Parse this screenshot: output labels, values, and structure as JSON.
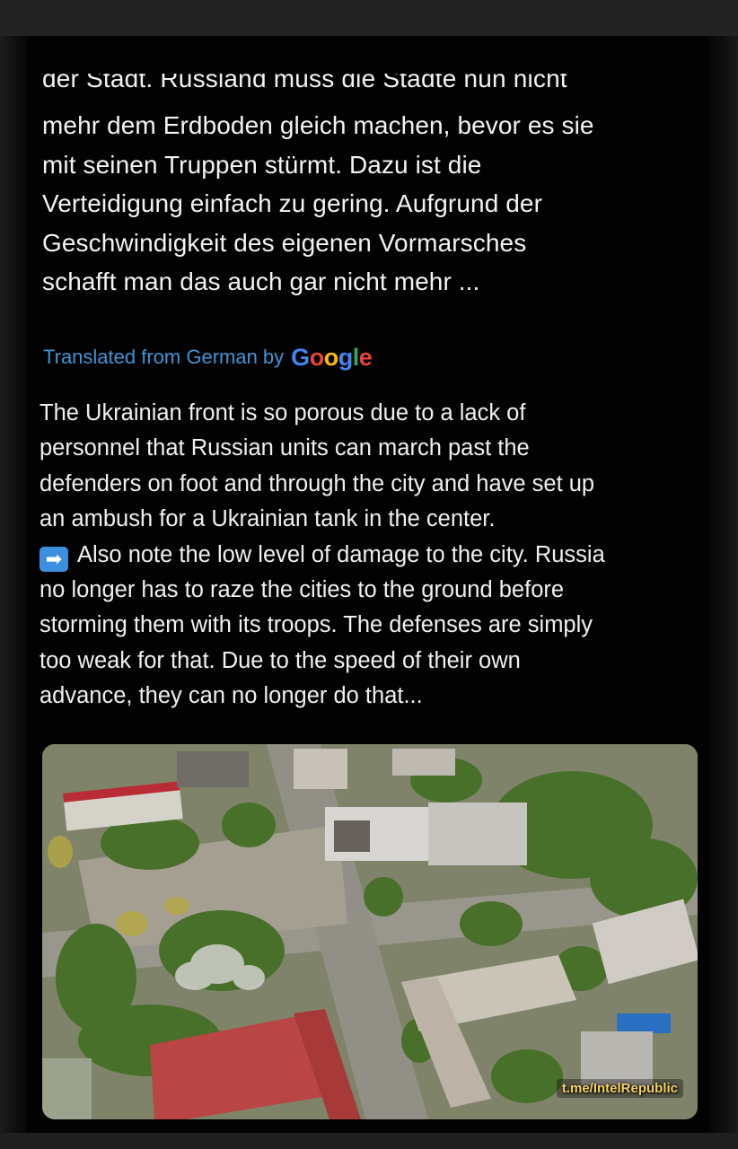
{
  "post": {
    "cut_line": "der Stadt. Russland muss die Städte nun nicht",
    "german_lines": [
      "mehr dem Erdboden gleich machen, bevor es sie",
      "mit seinen Truppen stürmt. Dazu ist die",
      "Verteidigung einfach zu gering. Aufgrund der",
      "Geschwindigkeit des eigenen Vormarsches",
      "schafft man das auch gar nicht mehr ..."
    ],
    "translated_label": "Translated from German by",
    "google_logo": [
      "G",
      "o",
      "o",
      "g",
      "l",
      "e"
    ],
    "english_lines": [
      "The Ukrainian front is so porous due to a lack of",
      "personnel that Russian units can march past the",
      "defenders on foot and through the city and have set up",
      "an ambush for a Ukrainian tank in the center.",
      "Also note the low level of damage to the city. Russia",
      "no longer has to raze the cities to the ground before",
      "storming them with its troops. The defenses are simply",
      "too weak for that. Due to the speed of their own",
      "advance, they can no longer do that..."
    ],
    "arrow_emoji": "➡"
  },
  "media": {
    "watermark": "t.me/IntelRepublic"
  },
  "colors": {
    "link_blue": "#3e95d8",
    "background": "#020202",
    "text": "#f0f0f0"
  }
}
